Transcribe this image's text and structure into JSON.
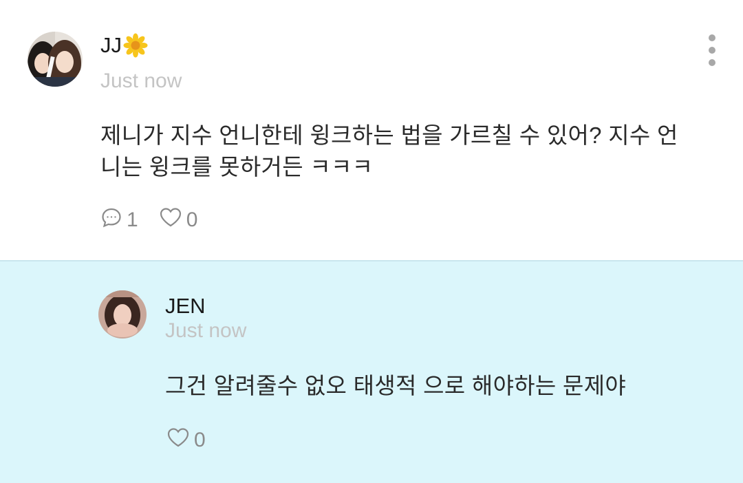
{
  "post": {
    "author": "JJ",
    "author_emoji": "sunflower-icon",
    "timestamp": "Just now",
    "text_line1": "제니가 지수 언니한테 윙크하는 법을 가르칠 수 있어? 지수 언",
    "text_line2": "니는 윙크를 못하거든 ㅋㅋㅋ",
    "comment_count": "1",
    "like_count": "0"
  },
  "reply": {
    "author": "JEN",
    "timestamp": "Just now",
    "text": "그건 알려줄수 없오 태생적 으로 해야하는 문제야",
    "like_count": "0"
  },
  "colors": {
    "reply_background": "#dbf6fb",
    "muted_text": "#c4c4c4",
    "icon_gray": "#8a8a8a"
  }
}
